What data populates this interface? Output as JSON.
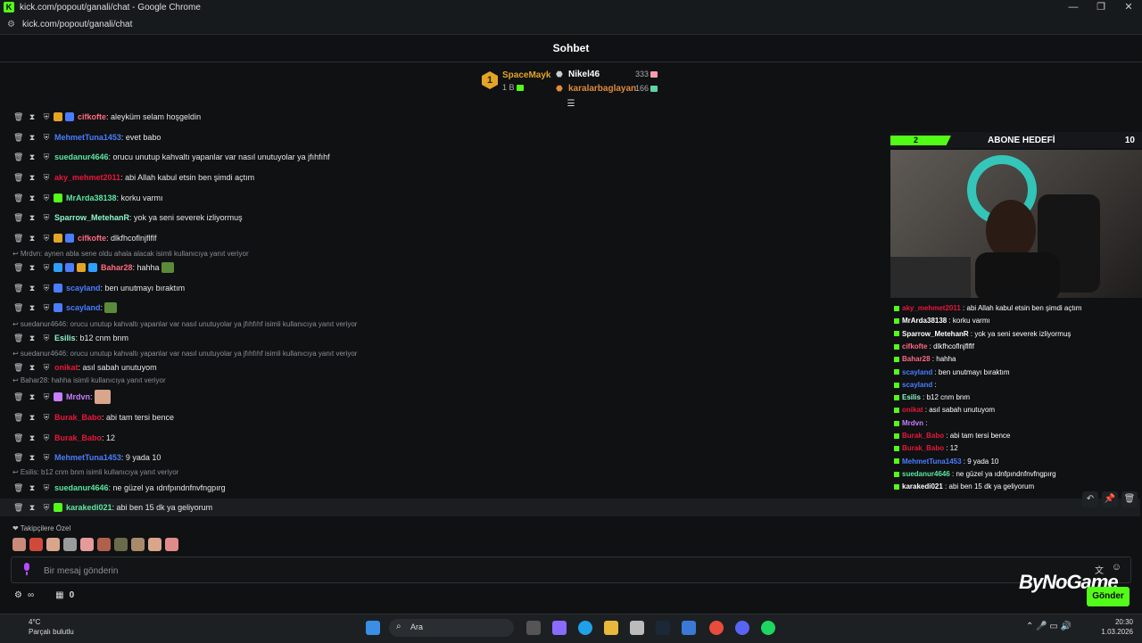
{
  "browser": {
    "title": "kick.com/popout/ganali/chat - Google Chrome",
    "url": "kick.com/popout/ganali/chat",
    "controls": [
      "—",
      "❐",
      "✕"
    ]
  },
  "chat_header": {
    "title": "Sohbet"
  },
  "leaderboard": {
    "first": {
      "rank": "1",
      "name": "SpaceMayk",
      "amount": "1 B"
    },
    "second": {
      "name": "Nikel46",
      "amount": "333"
    },
    "third": {
      "name": "karalarbaglayan",
      "amount": "166"
    }
  },
  "messages": [
    {
      "user": "cifkofte",
      "color": "#ff6b81",
      "text": ": aleyküm selam hoşgeldin"
    },
    {
      "user": "MehmetTuna1453",
      "color": "#4a7dff",
      "text": ": evet babo"
    },
    {
      "user": "suedanur4646",
      "color": "#5ce6a0",
      "text": ": orucu unutup kahvaltı yapanlar var nasıl unutuyolar ya jfıhfıhf"
    },
    {
      "user": "aky_mehmet2011",
      "color": "#e8173a",
      "text": ": abi Allah kabul etsin ben şimdi açtım"
    },
    {
      "user": "MrArda38138",
      "color": "#5ce6a0",
      "text": ": korku varmı"
    },
    {
      "user": "Sparrow_MetehanR",
      "color": "#8ff5c8",
      "text": ": yok ya seni severek izliyormuş"
    },
    {
      "user": "cifkofte",
      "color": "#ff6b81",
      "text": ": dlkfhcoflnjflflf"
    },
    {
      "reply": "Mrdvn: aynen abla sene oldu ahala alacak isimli kullanıcıya yanıt veriyor"
    },
    {
      "user": "Bahar28",
      "color": "#ff6b81",
      "text": ": hahha"
    },
    {
      "user": "scayland",
      "color": "#4a7dff",
      "text": ": ben unutmayı bıraktım"
    },
    {
      "user": "scayland",
      "color": "#4a7dff",
      "text": ":"
    },
    {
      "reply": "suedanur4646: orucu unutup kahvaltı yapanlar var nasıl unutuyolar ya jfıhfıhf isimli kullanıcıya yanıt veriyor"
    },
    {
      "user": "Esilis",
      "color": "#8ff5c8",
      "text": ": b12 cnm bnm"
    },
    {
      "reply": "suedanur4646: orucu unutup kahvaltı yapanlar var nasıl unutuyolar ya jfıhfıhf isimli kullanıcıya yanıt veriyor"
    },
    {
      "user": "onikat",
      "color": "#e8173a",
      "text": ": asıl sabah unutuyom"
    },
    {
      "reply": "Bahar28: hahha isimli kullanıcıya yanıt veriyor"
    },
    {
      "user": "Mrdvn",
      "color": "#c97dff",
      "text": ":"
    },
    {
      "user": "Burak_Babo",
      "color": "#e8173a",
      "text": ": abi tam tersi bence"
    },
    {
      "user": "Burak_Babo",
      "color": "#e8173a",
      "text": ": 12"
    },
    {
      "user": "MehmetTuna1453",
      "color": "#4a7dff",
      "text": ": 9 yada 10"
    },
    {
      "reply": "Esilis: b12 cnm bnm isimli kullanıcıya yanıt veriyor"
    },
    {
      "user": "suedanur4646",
      "color": "#5ce6a0",
      "text": ": ne güzel ya ıdnfpındnfnvfngpırg"
    },
    {
      "user": "karakedi021",
      "color": "#5ce6a0",
      "text": ": abi ben 15 dk ya geliyorum"
    }
  ],
  "overlay": {
    "goal_current": "2",
    "goal_title": "ABONE HEDEFİ",
    "goal_target": "10",
    "goal_progress": 0.2,
    "chat": [
      {
        "user": "aky_mehmet2011",
        "color": "#e8173a",
        "text": " : abi Allah kabul etsin ben şimdi açtım"
      },
      {
        "user": "MrArda38138",
        "color": "#ffffff",
        "text": " : korku varmı"
      },
      {
        "user": "Sparrow_MetehanR",
        "color": "#ffffff",
        "text": " : yok ya seni severek izliyormuş"
      },
      {
        "user": "cifkofte",
        "color": "#ff6b81",
        "text": " : dlkfhcoflnjflflf"
      },
      {
        "user": "Bahar28",
        "color": "#ff6b81",
        "text": " : hahha"
      },
      {
        "user": "scayland",
        "color": "#4a7dff",
        "text": " : ben unutmayı bıraktım"
      },
      {
        "user": "scayland",
        "color": "#4a7dff",
        "text": " :"
      },
      {
        "user": "Esilis",
        "color": "#8ff5c8",
        "text": " : b12 cnm bnm"
      },
      {
        "user": "onikat",
        "color": "#e8173a",
        "text": " : asıl sabah unutuyom"
      },
      {
        "user": "Mrdvn",
        "color": "#c97dff",
        "text": " :"
      },
      {
        "user": "Burak_Babo",
        "color": "#e8173a",
        "text": " : abi tam tersi bence"
      },
      {
        "user": "Burak_Babo",
        "color": "#e8173a",
        "text": " : 12"
      },
      {
        "user": "MehmetTuna1453",
        "color": "#4a7dff",
        "text": " : 9 yada 10"
      },
      {
        "user": "suedanur4646",
        "color": "#5ce6a0",
        "text": " : ne güzel ya ıdnfpındnfnvfngpırg"
      },
      {
        "user": "karakedi021",
        "color": "#ffffff",
        "text": " : abi ben 15 dk ya geliyorum"
      }
    ]
  },
  "followers_only": {
    "label": "Takipçilere Özel"
  },
  "input": {
    "placeholder": "Bir mesaj gönderin",
    "send_label": "Gönder"
  },
  "bottom": {
    "infinity": "∞",
    "points": "0"
  },
  "watermark": "ByNoGame",
  "taskbar": {
    "temp": "4°C",
    "weather": "Parçalı bulutlu",
    "search": "Ara",
    "time": "20:30",
    "date": "1.03.2026"
  },
  "colors": {
    "accent": "#53fc18",
    "bg": "#0f1113"
  }
}
